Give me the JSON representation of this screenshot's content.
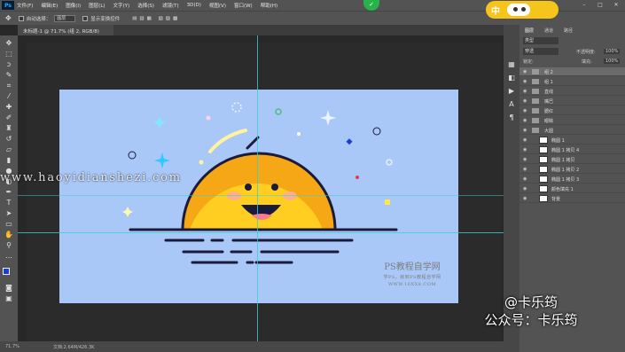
{
  "app": {
    "logo": "Ps",
    "menu": [
      "文件(F)",
      "编辑(E)",
      "图像(I)",
      "图层(L)",
      "文字(Y)",
      "选择(S)",
      "滤镜(T)",
      "3D(D)",
      "视图(V)",
      "窗口(W)",
      "帮助(H)"
    ]
  },
  "options_bar": {
    "auto_select_label": "自动选择：",
    "auto_select_value": "图层",
    "show_transform_label": "显示变换控件"
  },
  "document_tab": {
    "title": "未标题-1 @ 71.7% (组 2, RGB/8)"
  },
  "status_bar": {
    "zoom": "71.7%",
    "doc_info": "文档:2.64M/426.3K"
  },
  "panel": {
    "tabs": [
      "图层",
      "通道",
      "路径"
    ],
    "kind_label": "类型",
    "blend_mode": "穿透",
    "opacity_label": "不透明度:",
    "opacity_value": "100%",
    "lock_label": "锁定:",
    "fill_label": "填充:",
    "fill_value": "100%",
    "layers": [
      {
        "name": "组 2",
        "kind": "group",
        "selected": true
      },
      {
        "name": "组 1",
        "kind": "group"
      },
      {
        "name": "直线",
        "kind": "group"
      },
      {
        "name": "嘴巴",
        "kind": "group"
      },
      {
        "name": "腮红",
        "kind": "group"
      },
      {
        "name": "眼睛",
        "kind": "group"
      },
      {
        "name": "大圆",
        "kind": "group-open"
      },
      {
        "name": "椭圆 1",
        "kind": "layer"
      },
      {
        "name": "椭圆 1 拷贝 4",
        "kind": "layer"
      },
      {
        "name": "椭圆 1 拷贝",
        "kind": "layer"
      },
      {
        "name": "椭圆 1 拷贝 2",
        "kind": "layer"
      },
      {
        "name": "椭圆 1 拷贝 3",
        "kind": "layer"
      },
      {
        "name": "颜色填充 1",
        "kind": "layer"
      },
      {
        "name": "背景",
        "kind": "layer"
      }
    ]
  },
  "overlays": {
    "watermark_url": "www.haoyidianshezi.com",
    "credit_line1": "@卡乐筠",
    "credit_line2": "公众号：卡乐筠",
    "logo_title": "PS教程自学网",
    "logo_sub": "学PS，就到PS教程自学网",
    "logo_url": "WWW.16XX8.COM",
    "badge_text": "中"
  },
  "colors": {
    "artboard": "#a9c8f8",
    "sun": "#ffce21",
    "sun_shade": "#f5a716",
    "outline": "#1a1a3a",
    "guide": "#37d0d0"
  }
}
